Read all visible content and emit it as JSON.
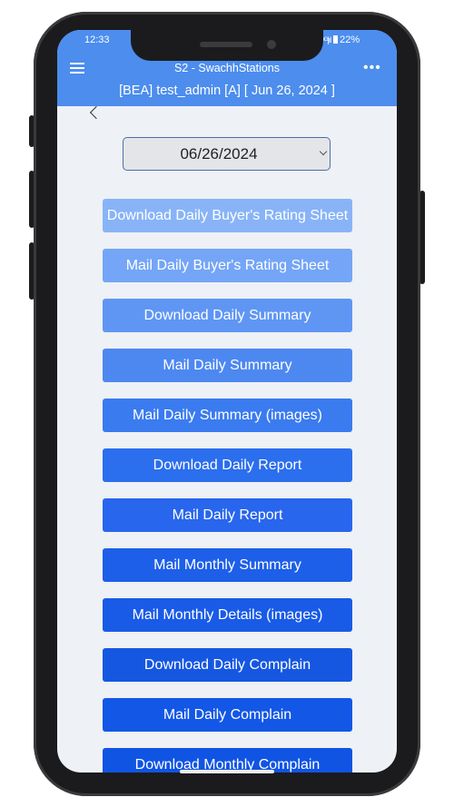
{
  "status_bar": {
    "time": "12:33",
    "battery": "22%",
    "signal": "⁴ᴳ|ıl"
  },
  "header": {
    "title": "S2 - SwachhStations",
    "subtitle": "[BEA] test_admin [A] [ Jun 26, 2024 ]",
    "menu_icon": "menu-icon",
    "more_icon": "more-vertical-icon",
    "more_glyph": "•••",
    "color": "#4c8dee"
  },
  "back_icon": "back-chevron-icon",
  "date_select": {
    "value": "06/26/2024"
  },
  "actions": [
    {
      "label": "Download Daily Buyer's Rating Sheet",
      "color": "#88b4f7"
    },
    {
      "label": "Mail Daily Buyer's Rating Sheet",
      "color": "#74a5f6"
    },
    {
      "label": "Download Daily Summary",
      "color": "#5f96f4"
    },
    {
      "label": "Mail Daily Summary",
      "color": "#4d88f1"
    },
    {
      "label": "Mail Daily Summary (images)",
      "color": "#3a7bf0"
    },
    {
      "label": "Download Daily Report",
      "color": "#2b6eee"
    },
    {
      "label": "Mail Daily Report",
      "color": "#2866ed"
    },
    {
      "label": "Mail Monthly Summary",
      "color": "#1d5fe8"
    },
    {
      "label": "Mail Monthly Details (images)",
      "color": "#195be7"
    },
    {
      "label": "Download Daily Complain",
      "color": "#1657e1"
    },
    {
      "label": "Mail Daily Complain",
      "color": "#1357e6"
    },
    {
      "label": "Download Monthly Complain",
      "color": "#1054e4"
    }
  ]
}
